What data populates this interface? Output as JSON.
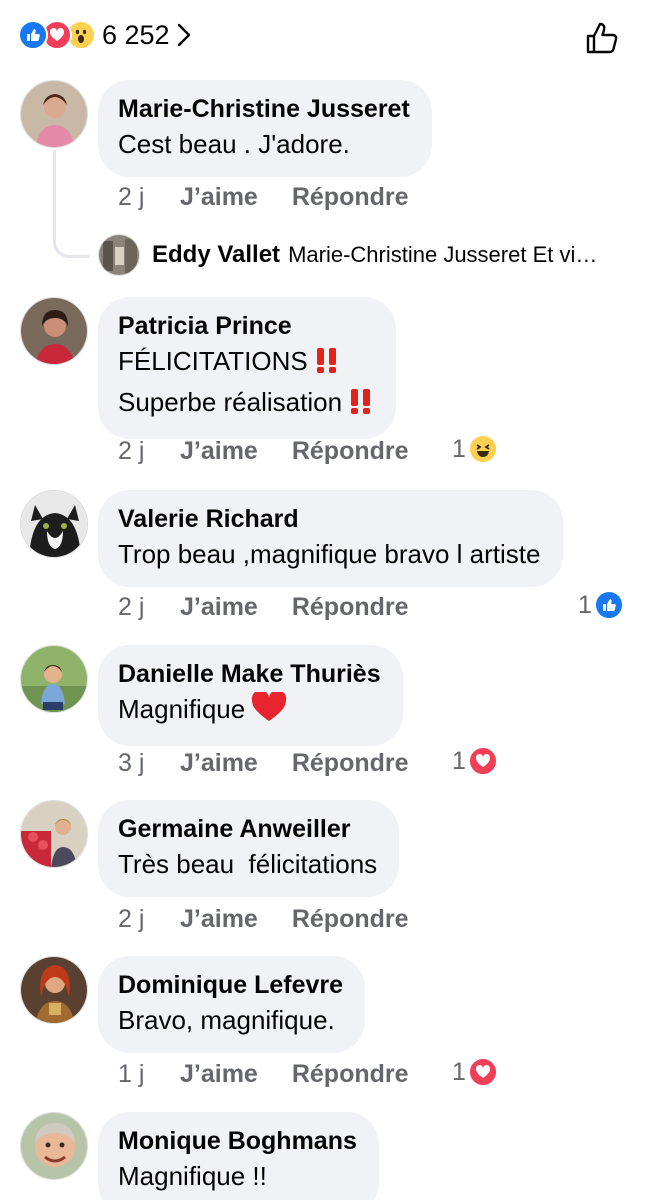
{
  "summary": {
    "reactions": [
      "like-icon",
      "love-icon",
      "wow-icon"
    ],
    "count": "6 252"
  },
  "reply_preview": {
    "author": "Eddy Vallet",
    "text": "Marie-Christine Jusseret Et vi…"
  },
  "comments": [
    {
      "author": "Marie-Christine Jusseret",
      "lines": [
        "Cest beau . J'adore."
      ],
      "time": "2 j",
      "like_label": "J’aime",
      "reply_label": "Répondre"
    },
    {
      "author": "Patricia Prince",
      "lines": [
        "FÉLICITATIONS",
        "Superbe réalisation"
      ],
      "time": "2 j",
      "like_label": "J’aime",
      "reply_label": "Répondre",
      "reaction": {
        "count": "1",
        "icon": "haha-icon"
      }
    },
    {
      "author": "Valerie Richard",
      "lines": [
        "Trop beau ,magnifique bravo l artiste"
      ],
      "time": "2 j",
      "like_label": "J’aime",
      "reply_label": "Répondre",
      "reaction": {
        "count": "1",
        "icon": "like-icon"
      }
    },
    {
      "author": "Danielle Make Thuriès",
      "lines": [
        "Magnifique"
      ],
      "time": "3 j",
      "like_label": "J’aime",
      "reply_label": "Répondre",
      "reaction": {
        "count": "1",
        "icon": "love-icon"
      }
    },
    {
      "author": "Germaine Anweiller",
      "lines": [
        "Très beau  félicitations"
      ],
      "time": "2 j",
      "like_label": "J’aime",
      "reply_label": "Répondre"
    },
    {
      "author": "Dominique Lefevre",
      "lines": [
        "Bravo, magnifique."
      ],
      "time": "1 j",
      "like_label": "J’aime",
      "reply_label": "Répondre",
      "reaction": {
        "count": "1",
        "icon": "love-icon"
      }
    },
    {
      "author": "Monique Boghmans",
      "lines": [
        "Magnifique !!"
      ]
    }
  ],
  "colors": {
    "bubble": "#f0f2f5",
    "secondary_text": "#65676b",
    "like_blue": "#1877f2",
    "love_red": "#f33e58",
    "haha_yellow": "#fcd050"
  }
}
